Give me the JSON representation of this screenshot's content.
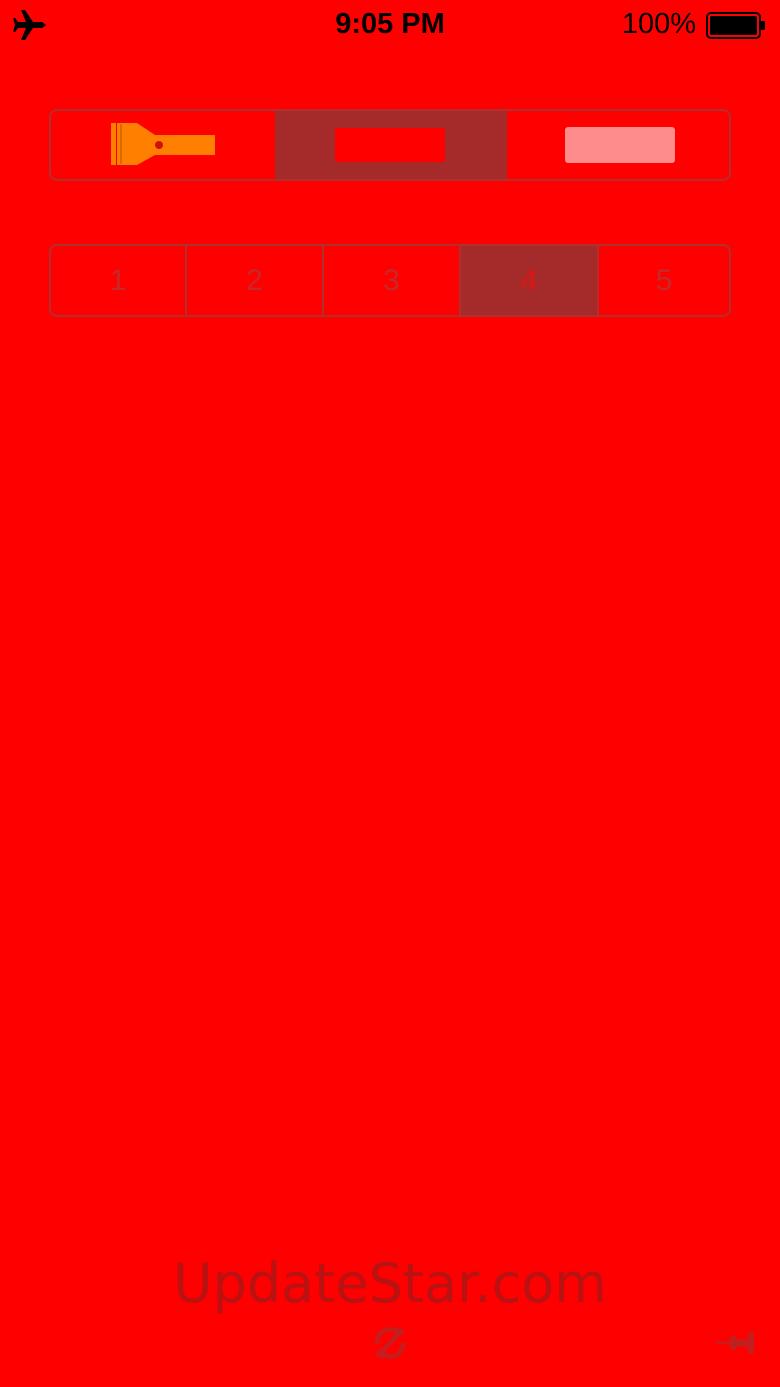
{
  "status_bar": {
    "time": "9:05 PM",
    "battery_percent": "100%",
    "left_icon": "airplane-icon",
    "right_icon": "battery-icon"
  },
  "mode_selector": {
    "segments": [
      {
        "name": "flashlight",
        "icon": "flashlight-icon",
        "color": "#ff8000"
      },
      {
        "name": "red-screen",
        "icon": "red-screen-swatch",
        "color": "#ff0000"
      },
      {
        "name": "pink-screen",
        "icon": "pink-screen-swatch",
        "color": "#ff8c8c"
      }
    ],
    "selected_index": 1
  },
  "level_selector": {
    "options": [
      "1",
      "2",
      "3",
      "4",
      "5"
    ],
    "selected": "4"
  },
  "watermark": "UpdateStar.com",
  "bottom_bar": {
    "left_icon": "refresh-icon",
    "right_icon": "pin-icon"
  },
  "colors": {
    "background": "#ff0000",
    "accent": "#a52a2a",
    "flashlight": "#ff8000"
  }
}
